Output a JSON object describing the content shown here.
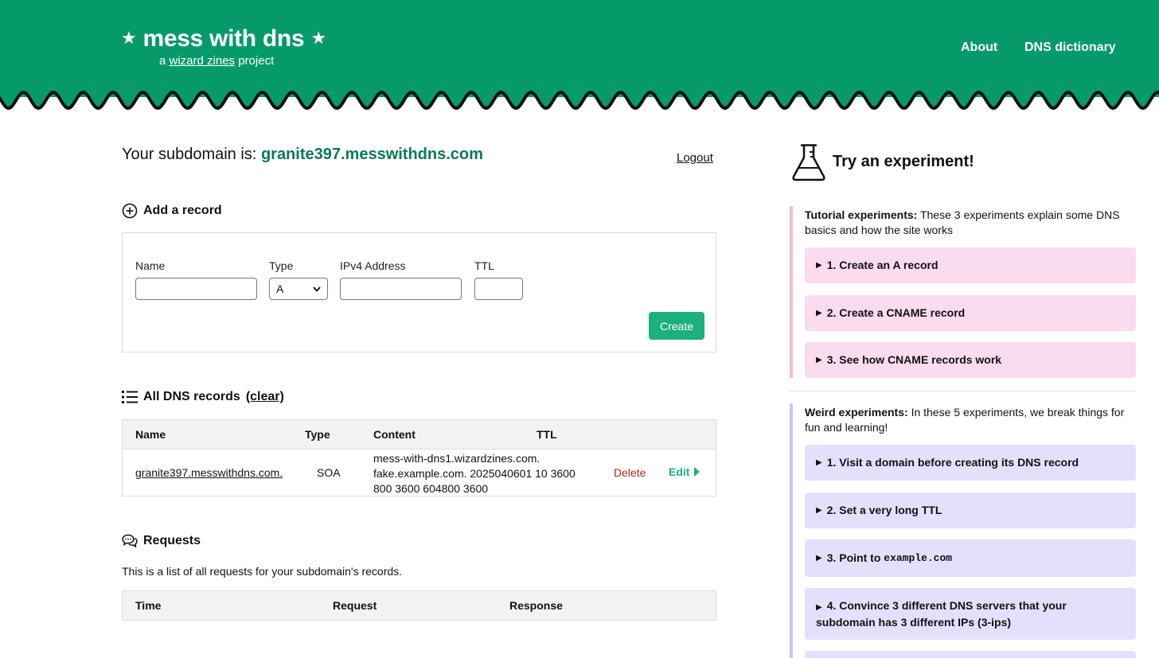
{
  "header": {
    "title": "mess with dns",
    "star": "★",
    "subtitle_prefix": "a",
    "subtitle_link": "wizard zines",
    "subtitle_suffix": "project",
    "nav": [
      "About",
      "DNS dictionary"
    ]
  },
  "subdomain": {
    "label": "Your subdomain is:",
    "value": "granite397.messwithdns.com",
    "logout": "Logout"
  },
  "add_record": {
    "title": "Add a record",
    "fields": {
      "name_label": "Name",
      "type_label": "Type",
      "type_value": "A",
      "address_label": "IPv4 Address",
      "ttl_label": "TTL"
    },
    "create_label": "Create"
  },
  "records": {
    "title": "All DNS records",
    "clear": "(clear)",
    "columns": [
      "Name",
      "Type",
      "Content",
      "TTL"
    ],
    "rows": [
      {
        "name": "granite397.messwithdns.com.",
        "type": "SOA",
        "content_lines": [
          "mess-with-dns1.wizardzines.com.",
          "fake.example.com. 2025040601 10 3600",
          "800 3600 604800 3600"
        ],
        "delete": "Delete",
        "edit": "Edit"
      }
    ]
  },
  "requests": {
    "title": "Requests",
    "description": "This is a list of all requests for your subdomain's records.",
    "columns": [
      "Time",
      "Request",
      "Response"
    ]
  },
  "experiments": {
    "title": "Try an experiment!",
    "tutorial": {
      "heading": "Tutorial experiments:",
      "description": "These 3 experiments explain some DNS basics and how the site works",
      "items": [
        "1. Create an A record",
        "2. Create a CNAME record",
        "3. See how CNAME records work"
      ]
    },
    "weird": {
      "heading": "Weird experiments:",
      "description": "In these 5 experiments, we break things for fun and learning!",
      "items": [
        "1. Visit a domain before creating its DNS record",
        "2. Set a very long TTL",
        "3. Point to",
        "4. Convince 3 different DNS servers that your subdomain has 3 different IPs (3-ips)"
      ],
      "item3_code": "example.com"
    },
    "colors": {
      "tutorial": "#fbdbee",
      "weird": "#e4e0fb",
      "tutorial_bar": "#f5b8d8",
      "weird_bar": "#cbc3f6"
    }
  },
  "colors": {
    "brand": "#069a6b",
    "accent": "#1bb07d",
    "link_green": "#0b7a55",
    "delete": "#b3261e"
  }
}
